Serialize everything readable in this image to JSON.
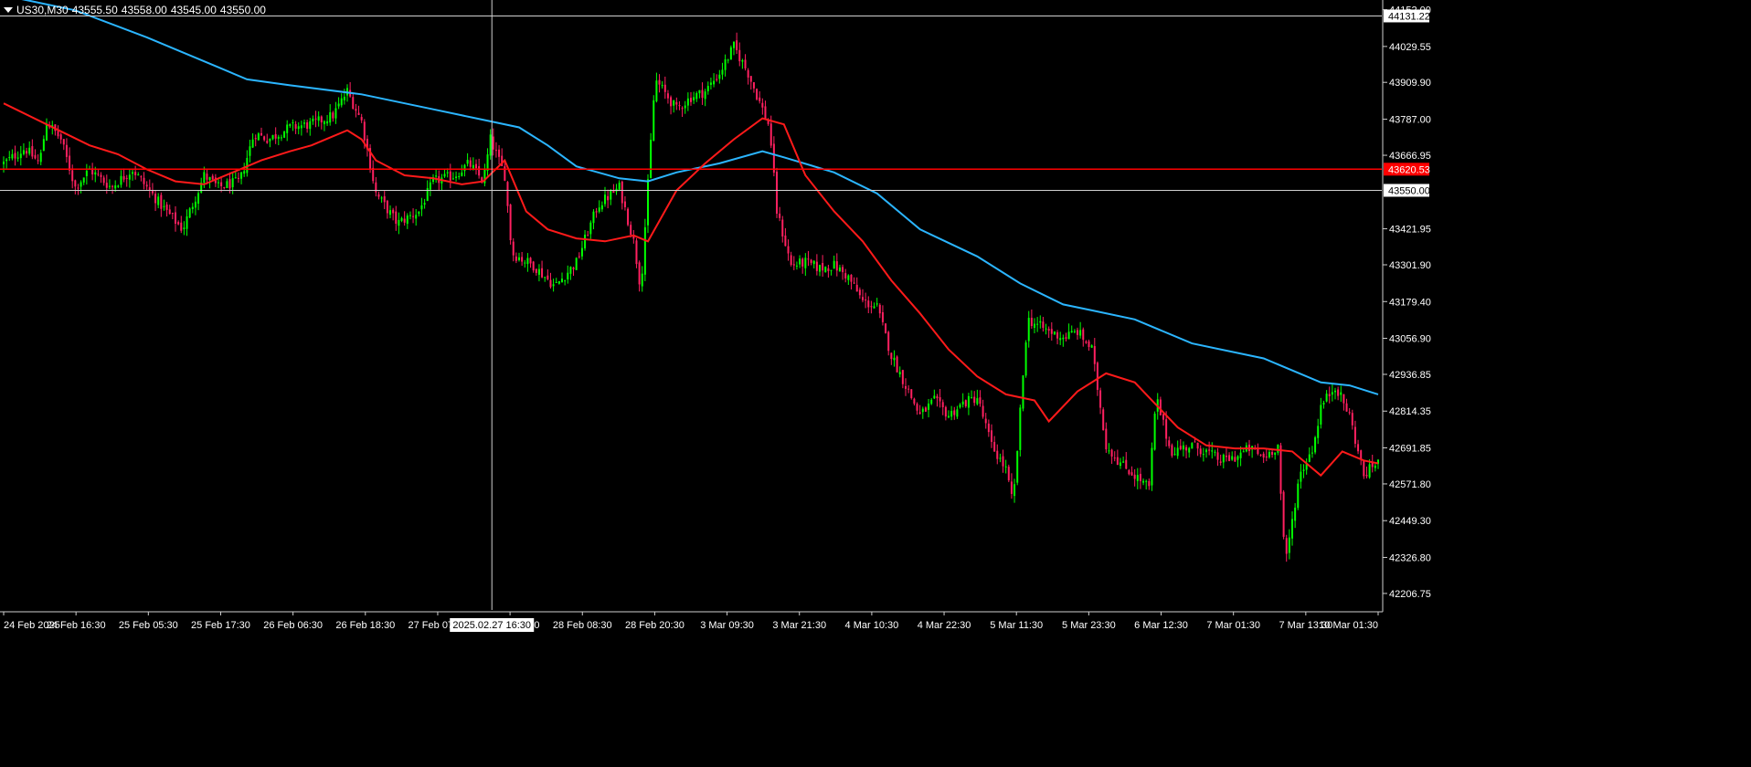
{
  "header": {
    "symbol_label": "US30,M30",
    "ohlc": [
      "43555.50",
      "43558.00",
      "43545.00",
      "43550.00"
    ]
  },
  "colors": {
    "background": "#000000",
    "bull": "#00ff00",
    "bear": "#ff2060",
    "fast_ma": "#ff1a1a",
    "slow_ma": "#2bb5ff",
    "grid_text": "#ffffff",
    "bid_line": "#ff0000"
  },
  "chart_data": {
    "type": "candlestick",
    "y_ticks": [
      "44152.00",
      "44029.55",
      "43909.90",
      "43787.00",
      "43666.95",
      "43421.95",
      "43301.90",
      "43179.40",
      "43056.90",
      "42936.85",
      "42814.35",
      "42691.85",
      "42571.80",
      "42449.30",
      "42326.80",
      "42206.75"
    ],
    "x_ticks": [
      "24 Feb 2025",
      "24 Feb 16:30",
      "25 Feb 05:30",
      "25 Feb 17:30",
      "26 Feb 06:30",
      "26 Feb 18:30",
      "27 Feb 07:30",
      "27 Feb 19:30",
      "28 Feb 08:30",
      "28 Feb 20:30",
      "3 Mar 09:30",
      "3 Mar 21:30",
      "4 Mar 10:30",
      "4 Mar 22:30",
      "5 Mar 11:30",
      "5 Mar 23:30",
      "6 Mar 12:30",
      "7 Mar 01:30",
      "7 Mar 13:30",
      "10 Mar 01:30"
    ],
    "ylim": [
      42170,
      44160
    ],
    "price_labels": {
      "top_line": "44131.22",
      "bid": "43620.53",
      "crosshair": "43550.00"
    },
    "crosshair_time": "2025.02.27 16:30",
    "close_path": [
      [
        0,
        43640
      ],
      [
        15,
        43690
      ],
      [
        25,
        43640
      ],
      [
        30,
        43780
      ],
      [
        40,
        43720
      ],
      [
        50,
        43560
      ],
      [
        60,
        43620
      ],
      [
        75,
        43560
      ],
      [
        90,
        43620
      ],
      [
        110,
        43500
      ],
      [
        125,
        43420
      ],
      [
        140,
        43600
      ],
      [
        150,
        43560
      ],
      [
        165,
        43580
      ],
      [
        175,
        43740
      ],
      [
        185,
        43720
      ],
      [
        200,
        43760
      ],
      [
        215,
        43770
      ],
      [
        230,
        43800
      ],
      [
        240,
        43880
      ],
      [
        250,
        43780
      ],
      [
        260,
        43540
      ],
      [
        275,
        43440
      ],
      [
        290,
        43480
      ],
      [
        300,
        43580
      ],
      [
        315,
        43600
      ],
      [
        325,
        43640
      ],
      [
        335,
        43580
      ],
      [
        340,
        43720
      ],
      [
        350,
        43600
      ],
      [
        355,
        43340
      ],
      [
        370,
        43300
      ],
      [
        385,
        43230
      ],
      [
        400,
        43310
      ],
      [
        415,
        43500
      ],
      [
        430,
        43560
      ],
      [
        440,
        43380
      ],
      [
        445,
        43220
      ],
      [
        455,
        43920
      ],
      [
        470,
        43820
      ],
      [
        480,
        43860
      ],
      [
        490,
        43880
      ],
      [
        500,
        43940
      ],
      [
        510,
        44030
      ],
      [
        520,
        43940
      ],
      [
        530,
        43820
      ],
      [
        535,
        43760
      ],
      [
        540,
        43480
      ],
      [
        550,
        43300
      ],
      [
        560,
        43310
      ],
      [
        570,
        43290
      ],
      [
        580,
        43300
      ],
      [
        590,
        43260
      ],
      [
        600,
        43180
      ],
      [
        610,
        43160
      ],
      [
        620,
        43000
      ],
      [
        630,
        42900
      ],
      [
        640,
        42800
      ],
      [
        650,
        42850
      ],
      [
        660,
        42800
      ],
      [
        670,
        42840
      ],
      [
        680,
        42860
      ],
      [
        690,
        42700
      ],
      [
        700,
        42620
      ],
      [
        705,
        42500
      ],
      [
        715,
        43120
      ],
      [
        730,
        43080
      ],
      [
        740,
        43060
      ],
      [
        750,
        43080
      ],
      [
        760,
        43020
      ],
      [
        770,
        42700
      ],
      [
        780,
        42640
      ],
      [
        790,
        42600
      ],
      [
        800,
        42560
      ],
      [
        805,
        42860
      ],
      [
        815,
        42680
      ],
      [
        830,
        42700
      ],
      [
        840,
        42680
      ],
      [
        850,
        42650
      ],
      [
        860,
        42660
      ],
      [
        870,
        42690
      ],
      [
        880,
        42660
      ],
      [
        890,
        42700
      ],
      [
        895,
        42300
      ],
      [
        905,
        42600
      ],
      [
        915,
        42700
      ],
      [
        920,
        42830
      ],
      [
        930,
        42900
      ],
      [
        940,
        42800
      ],
      [
        950,
        42600
      ],
      [
        960,
        42650
      ]
    ],
    "fast_ma_path": [
      [
        0,
        43840
      ],
      [
        30,
        43770
      ],
      [
        60,
        43700
      ],
      [
        80,
        43670
      ],
      [
        100,
        43620
      ],
      [
        120,
        43580
      ],
      [
        140,
        43570
      ],
      [
        160,
        43610
      ],
      [
        180,
        43650
      ],
      [
        200,
        43680
      ],
      [
        215,
        43700
      ],
      [
        225,
        43720
      ],
      [
        240,
        43750
      ],
      [
        250,
        43720
      ],
      [
        260,
        43650
      ],
      [
        280,
        43600
      ],
      [
        300,
        43590
      ],
      [
        320,
        43570
      ],
      [
        335,
        43580
      ],
      [
        350,
        43650
      ],
      [
        365,
        43480
      ],
      [
        380,
        43420
      ],
      [
        400,
        43390
      ],
      [
        420,
        43380
      ],
      [
        440,
        43400
      ],
      [
        450,
        43380
      ],
      [
        470,
        43550
      ],
      [
        490,
        43640
      ],
      [
        510,
        43720
      ],
      [
        530,
        43790
      ],
      [
        545,
        43770
      ],
      [
        560,
        43600
      ],
      [
        580,
        43480
      ],
      [
        600,
        43380
      ],
      [
        620,
        43250
      ],
      [
        640,
        43140
      ],
      [
        660,
        43020
      ],
      [
        680,
        42930
      ],
      [
        700,
        42870
      ],
      [
        720,
        42850
      ],
      [
        730,
        42780
      ],
      [
        750,
        42880
      ],
      [
        770,
        42940
      ],
      [
        790,
        42910
      ],
      [
        800,
        42860
      ],
      [
        820,
        42760
      ],
      [
        840,
        42700
      ],
      [
        860,
        42690
      ],
      [
        880,
        42690
      ],
      [
        900,
        42680
      ],
      [
        920,
        42600
      ],
      [
        935,
        42680
      ],
      [
        950,
        42650
      ],
      [
        960,
        42640
      ]
    ],
    "slow_ma_path": [
      [
        0,
        44200
      ],
      [
        50,
        44150
      ],
      [
        100,
        44060
      ],
      [
        150,
        43960
      ],
      [
        170,
        43920
      ],
      [
        200,
        43900
      ],
      [
        250,
        43870
      ],
      [
        300,
        43820
      ],
      [
        340,
        43780
      ],
      [
        360,
        43760
      ],
      [
        380,
        43700
      ],
      [
        400,
        43630
      ],
      [
        430,
        43590
      ],
      [
        450,
        43580
      ],
      [
        470,
        43610
      ],
      [
        500,
        43640
      ],
      [
        530,
        43680
      ],
      [
        545,
        43660
      ],
      [
        580,
        43610
      ],
      [
        610,
        43540
      ],
      [
        640,
        43420
      ],
      [
        680,
        43330
      ],
      [
        710,
        43240
      ],
      [
        740,
        43170
      ],
      [
        760,
        43150
      ],
      [
        790,
        43120
      ],
      [
        830,
        43040
      ],
      [
        880,
        42990
      ],
      [
        920,
        42910
      ],
      [
        940,
        42900
      ],
      [
        960,
        42870
      ]
    ]
  }
}
